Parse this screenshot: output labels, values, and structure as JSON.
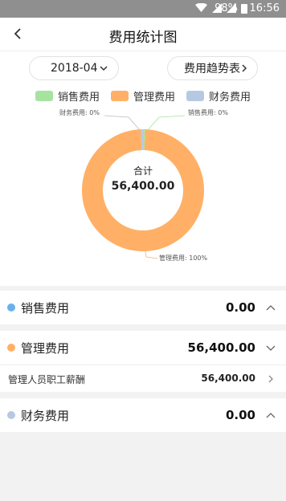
{
  "status_bar": {
    "battery": "98%",
    "time": "16:56"
  },
  "header": {
    "title": "费用统计图"
  },
  "filters": {
    "month": "2018-04",
    "trend_button": "费用趋势表"
  },
  "colors": {
    "sales": "#a6e3a1",
    "management": "#ffb066",
    "finance": "#b7c9e2"
  },
  "chart_data": {
    "type": "pie",
    "categories": [
      "销售费用",
      "管理费用",
      "财务费用"
    ],
    "values": [
      0,
      56400,
      0
    ],
    "percentages": [
      0,
      100,
      0
    ],
    "callouts": [
      "财务费用: 0%",
      "销售费用: 0%",
      "管理费用: 100%"
    ],
    "center_label": "合计",
    "center_value": "56,400.00",
    "legend_placement": "top"
  },
  "legend": [
    {
      "label": "销售费用"
    },
    {
      "label": "管理费用"
    },
    {
      "label": "财务费用"
    }
  ],
  "categories": [
    {
      "label": "销售费用",
      "amount": "0.00",
      "expanded": false
    },
    {
      "label": "管理费用",
      "amount": "56,400.00",
      "expanded": true,
      "sub_items": [
        {
          "label": "管理人员职工薪酬",
          "amount": "56,400.00"
        }
      ]
    },
    {
      "label": "财务费用",
      "amount": "0.00",
      "expanded": false
    }
  ]
}
